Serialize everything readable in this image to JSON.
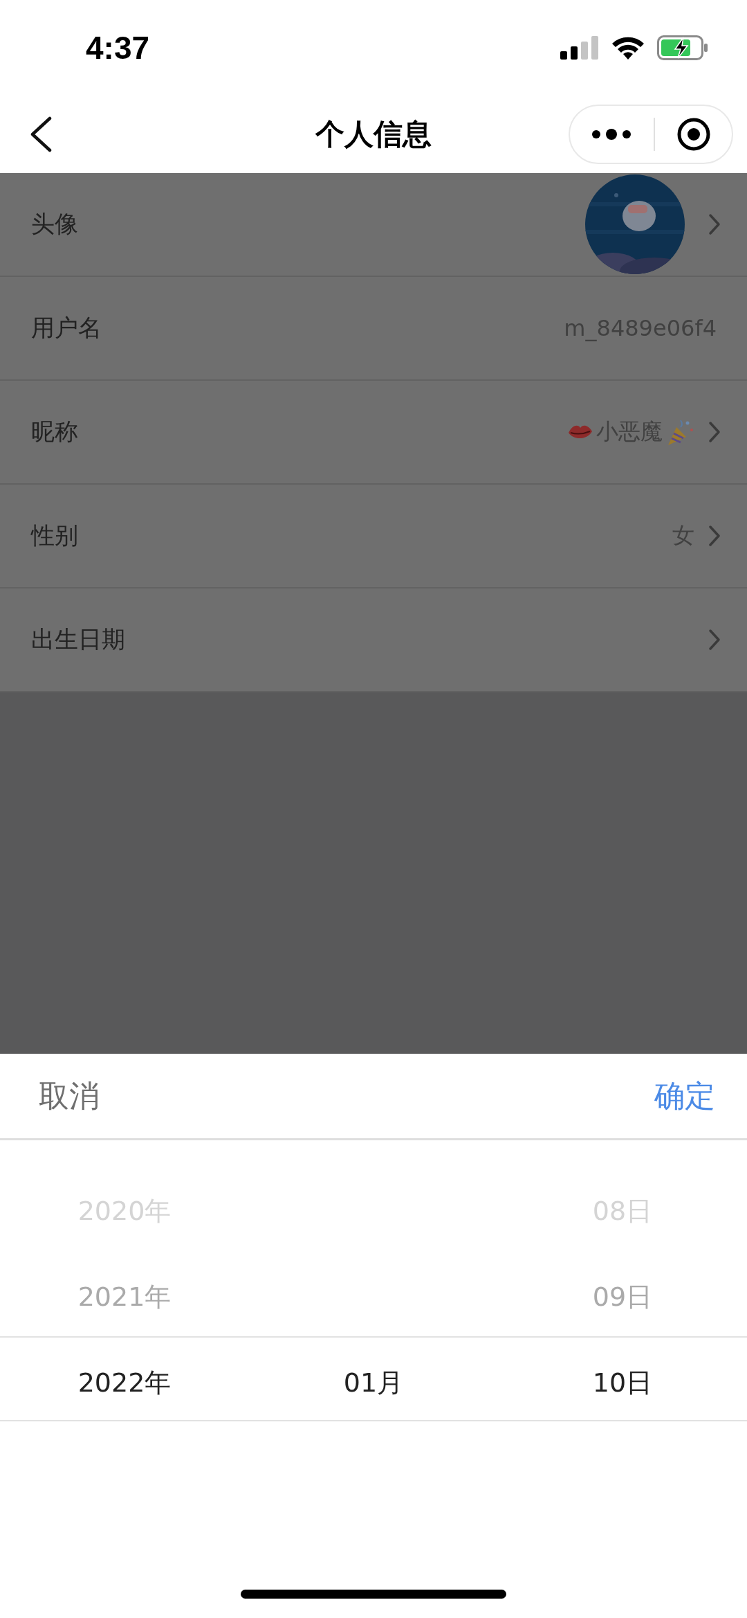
{
  "status_bar": {
    "time": "4:37"
  },
  "nav": {
    "title": "个人信息"
  },
  "rows": [
    {
      "label": "头像",
      "kind": "avatar",
      "chevron": true
    },
    {
      "label": "用户名",
      "kind": "text",
      "value": "m_8489e06f4",
      "chevron": false
    },
    {
      "label": "昵称",
      "kind": "decorated",
      "value": "小恶魔",
      "chevron": true
    },
    {
      "label": "性别",
      "kind": "text",
      "value": "女",
      "chevron": true
    },
    {
      "label": "出生日期",
      "kind": "text",
      "chevron": true
    }
  ],
  "picker": {
    "cancel": "取消",
    "confirm": "确定",
    "columns": [
      {
        "items": [
          {
            "label": "2020年",
            "selected": false
          },
          {
            "label": "2021年",
            "selected": false
          },
          {
            "label": "2022年",
            "selected": true
          }
        ]
      },
      {
        "items": [
          {
            "label": "01月",
            "selected": true
          }
        ]
      },
      {
        "items": [
          {
            "label": "08日",
            "selected": false
          },
          {
            "label": "09日",
            "selected": false
          },
          {
            "label": "10日",
            "selected": true
          }
        ]
      }
    ]
  }
}
